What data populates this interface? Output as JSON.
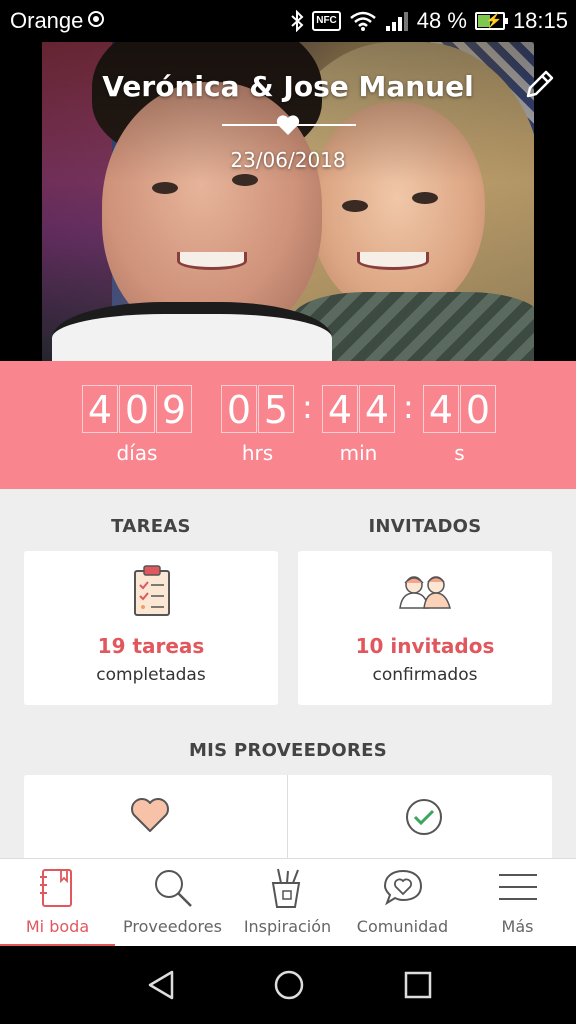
{
  "status_bar": {
    "carrier": "Orange",
    "nfc": "NFC",
    "battery_percent": "48 %",
    "battery_level": 0.48,
    "time": "18:15"
  },
  "hero": {
    "names": "Verónica & Jose Manuel",
    "date": "23/06/2018"
  },
  "countdown": {
    "days": [
      "4",
      "0",
      "9"
    ],
    "hours": [
      "0",
      "5"
    ],
    "minutes": [
      "4",
      "4"
    ],
    "seconds": [
      "4",
      "0"
    ],
    "separator": ":",
    "labels": {
      "days": "días",
      "hours": "hrs",
      "minutes": "min",
      "seconds": "s"
    }
  },
  "tareas": {
    "title": "TAREAS",
    "count": "19 tareas",
    "desc": "completadas",
    "icon": "clipboard-icon"
  },
  "invitados": {
    "title": "INVITADOS",
    "count": "10 invitados",
    "desc": "confirmados",
    "icon": "guests-icon"
  },
  "proveedores": {
    "title": "MIS PROVEEDORES",
    "left_icon": "heart-icon",
    "right_icon": "check-circle-icon"
  },
  "nav": {
    "items": [
      {
        "label": "Mi boda",
        "icon": "notebook-icon",
        "active": true
      },
      {
        "label": "Proveedores",
        "icon": "search-icon",
        "active": false
      },
      {
        "label": "Inspiración",
        "icon": "brushes-icon",
        "active": false
      },
      {
        "label": "Comunidad",
        "icon": "chat-heart-icon",
        "active": false
      },
      {
        "label": "Más",
        "icon": "menu-icon",
        "active": false
      }
    ]
  },
  "colors": {
    "accent": "#e0585e",
    "countdown_bg": "#f9868f",
    "content_bg": "#eeeeee"
  }
}
